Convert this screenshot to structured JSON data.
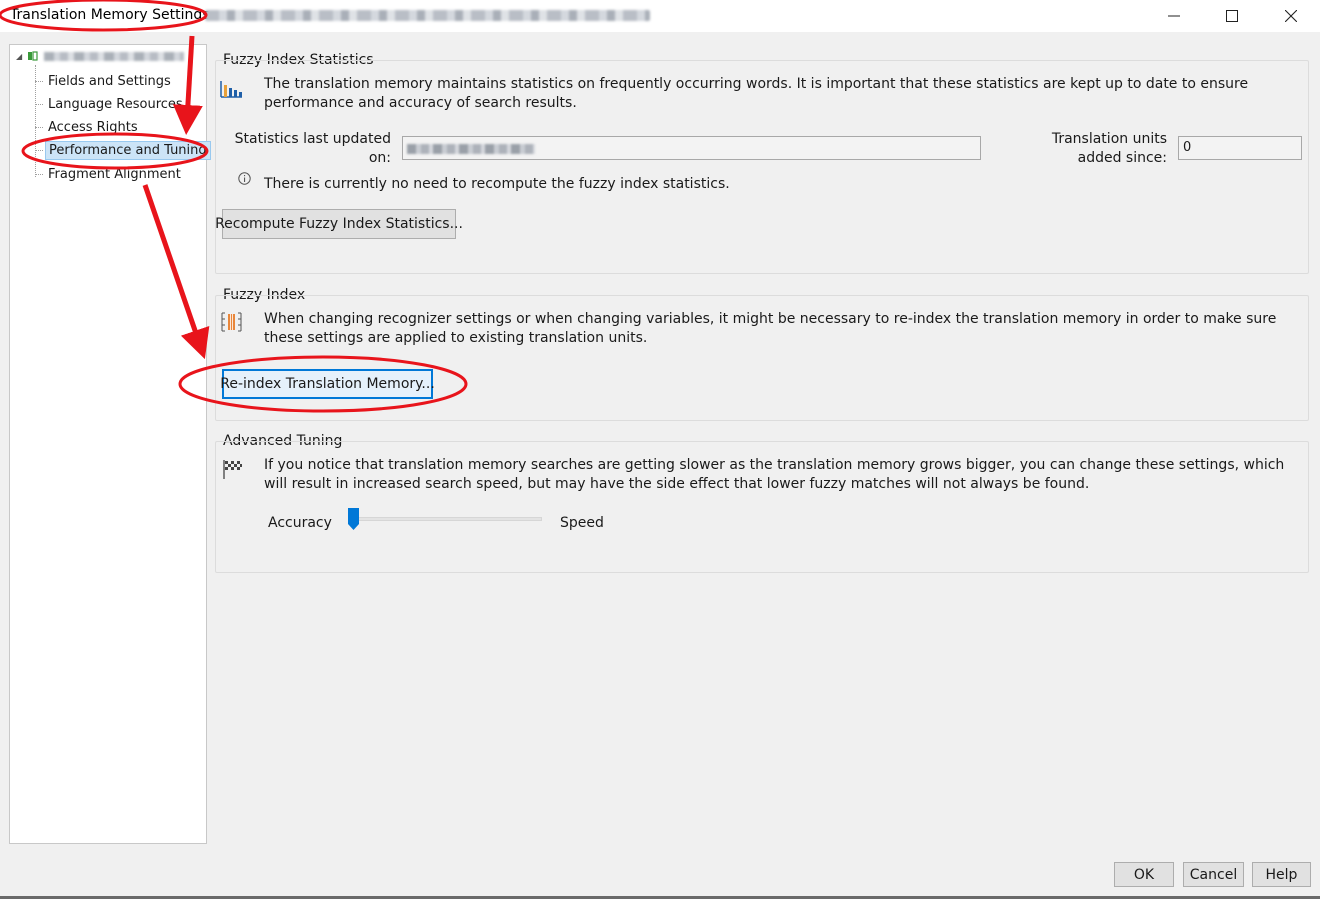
{
  "window": {
    "title": "Translation Memory Settings",
    "minimize_glyph": "─",
    "maximize_glyph": "☐",
    "close_glyph": "✕"
  },
  "tree": {
    "items": [
      {
        "label": "Fields and Settings"
      },
      {
        "label": "Language Resources"
      },
      {
        "label": "Access Rights"
      },
      {
        "label": "Performance and Tuning",
        "selected": true
      },
      {
        "label": "Fragment Alignment"
      }
    ]
  },
  "fuzzy_stats": {
    "heading": "Fuzzy Index Statistics",
    "description": "The translation memory maintains statistics on frequently occurring words. It is important that these statistics are kept up to date to ensure performance and accuracy of search results.",
    "last_updated_label": "Statistics last updated on:",
    "units_added_label": "Translation units added since:",
    "units_added_value": "0",
    "info_text": "There is currently no need to recompute the fuzzy index statistics.",
    "recompute_button": "Recompute Fuzzy Index Statistics..."
  },
  "fuzzy_index": {
    "heading": "Fuzzy Index",
    "description": "When changing recognizer settings or when changing variables, it might be necessary to re-index the translation memory in order to make sure these settings are applied to existing translation units.",
    "reindex_button": "Re-index Translation Memory..."
  },
  "advanced_tuning": {
    "heading": "Advanced Tuning",
    "description": "If you notice that translation memory searches are getting slower as the translation memory grows bigger, you can change these settings, which will result in increased search speed, but may have the side effect that lower fuzzy matches will not always be found.",
    "slider_left_label": "Accuracy",
    "slider_right_label": "Speed",
    "slider_value": 0.0
  },
  "footer": {
    "ok": "OK",
    "cancel": "Cancel",
    "help": "Help"
  },
  "colors": {
    "annotation_red": "#e8141b",
    "focus_blue": "#0078d7",
    "selection_bg": "#cce4f7",
    "slider_thumb": "#0078d7"
  }
}
